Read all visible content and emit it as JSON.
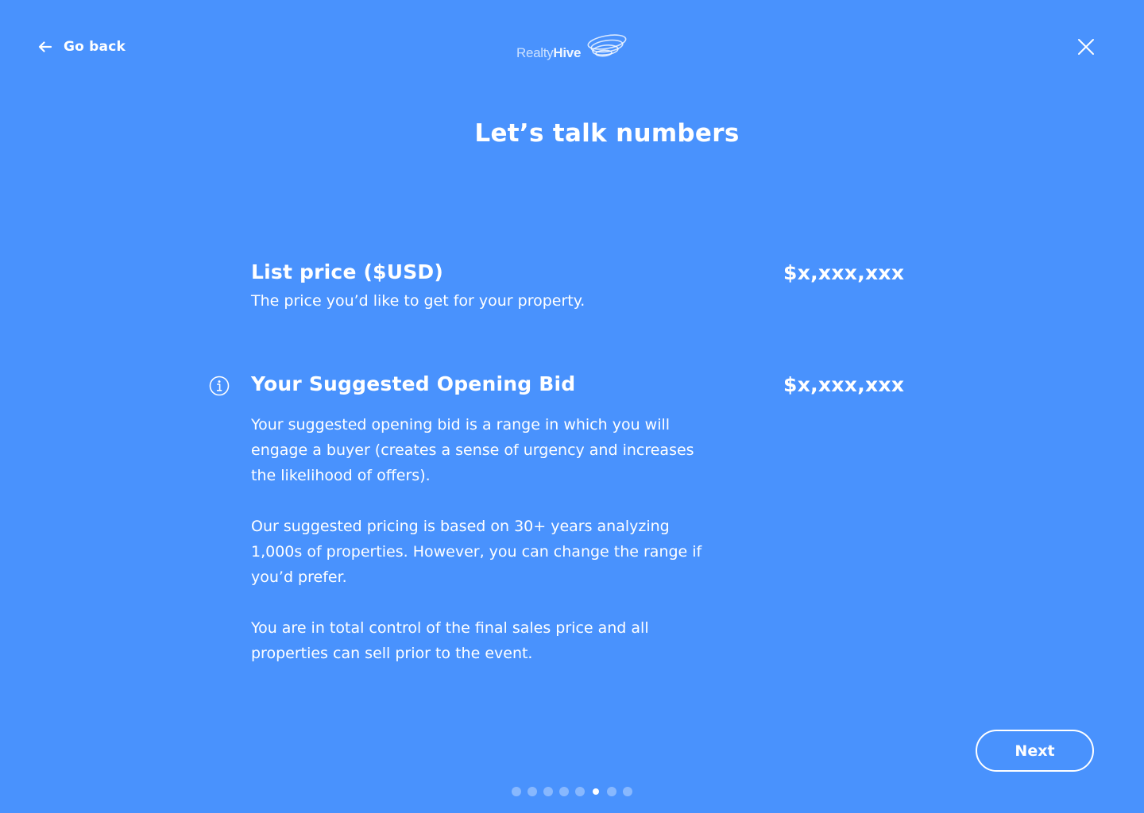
{
  "header": {
    "back_label": "Go back",
    "logo": {
      "text_primary": "Realty",
      "text_secondary": "Hive"
    },
    "close_icon": "close-icon"
  },
  "main": {
    "title": "Let’s talk numbers",
    "list_price": {
      "title": "List price ($USD)",
      "subtitle": "The price you’d like to get for your property.",
      "value": "$x,xxx,xxx"
    },
    "opening_bid": {
      "title": "Your Suggested Opening Bid",
      "value": "$x,xxx,xxx",
      "info_icon": "info-icon",
      "paragraphs": [
        "Your suggested opening bid is a range in which you will engage a buyer (creates a sense of urgency and increases the likelihood of offers).",
        "Our suggested pricing is based on 30+ years analyzing 1,000s of properties. However, you can change the range if you’d prefer.",
        "You are in total control of the final sales price and all properties can sell prior to the event."
      ]
    }
  },
  "footer": {
    "next_label": "Next",
    "pagination": {
      "total": 8,
      "current": 6
    }
  },
  "colors": {
    "background": "#4992fd",
    "text": "#ffffff"
  }
}
